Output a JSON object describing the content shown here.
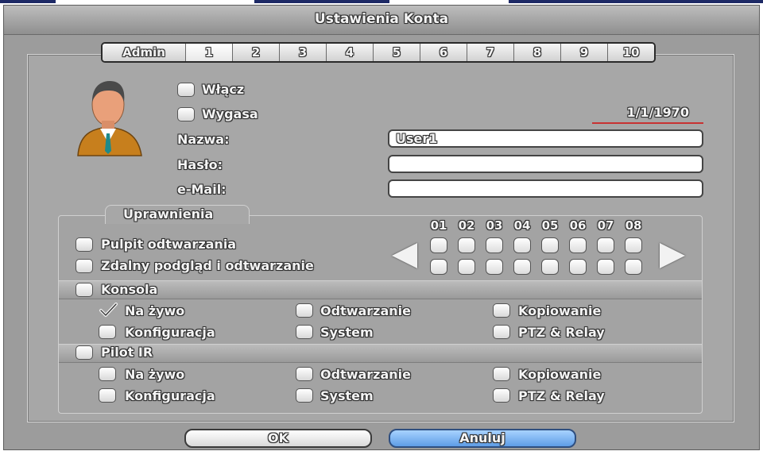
{
  "window": {
    "title": "Ustawienia Konta"
  },
  "tabs": [
    "Admin",
    "1",
    "2",
    "3",
    "4",
    "5",
    "6",
    "7",
    "8",
    "9",
    "10"
  ],
  "active_tab": "1",
  "account": {
    "enable_label": "Włącz",
    "expire_label": "Wygasa",
    "expire_date": "1/1/1970",
    "name_label": "Nazwa:",
    "name_value": "User1",
    "password_label": "Hasło:",
    "password_value": "",
    "email_label": "e-Mail:",
    "email_value": ""
  },
  "permissions": {
    "tab_label": "Uprawnienia",
    "playback_desktop": "Pulpit odtwarzania",
    "remote_view": "Zdalny podgląd i odtwarzanie",
    "channels": [
      "01",
      "02",
      "03",
      "04",
      "05",
      "06",
      "07",
      "08"
    ],
    "console": {
      "label": "Konsola",
      "items": [
        {
          "label": "Na żywo",
          "checked": true
        },
        {
          "label": "Odtwarzanie",
          "checked": false
        },
        {
          "label": "Kopiowanie",
          "checked": false
        },
        {
          "label": "Konfiguracja",
          "checked": false
        },
        {
          "label": "System",
          "checked": false
        },
        {
          "label": "PTZ & Relay",
          "checked": false
        }
      ]
    },
    "ir_remote": {
      "label": "Pilot IR",
      "items": [
        {
          "label": "Na żywo",
          "checked": false
        },
        {
          "label": "Odtwarzanie",
          "checked": false
        },
        {
          "label": "Kopiowanie",
          "checked": false
        },
        {
          "label": "Konfiguracja",
          "checked": false
        },
        {
          "label": "System",
          "checked": false
        },
        {
          "label": "PTZ & Relay",
          "checked": false
        }
      ]
    }
  },
  "buttons": {
    "ok": "OK",
    "cancel": "Anuluj"
  },
  "colors": {
    "cancel_button": "#5e9de6",
    "date_underline": "#c83232",
    "top_strip": "#1e2a66"
  },
  "icons": {
    "avatar": "user-avatar-icon",
    "left": "arrow-left-icon",
    "right": "arrow-right-icon",
    "check": "checkmark-icon"
  }
}
